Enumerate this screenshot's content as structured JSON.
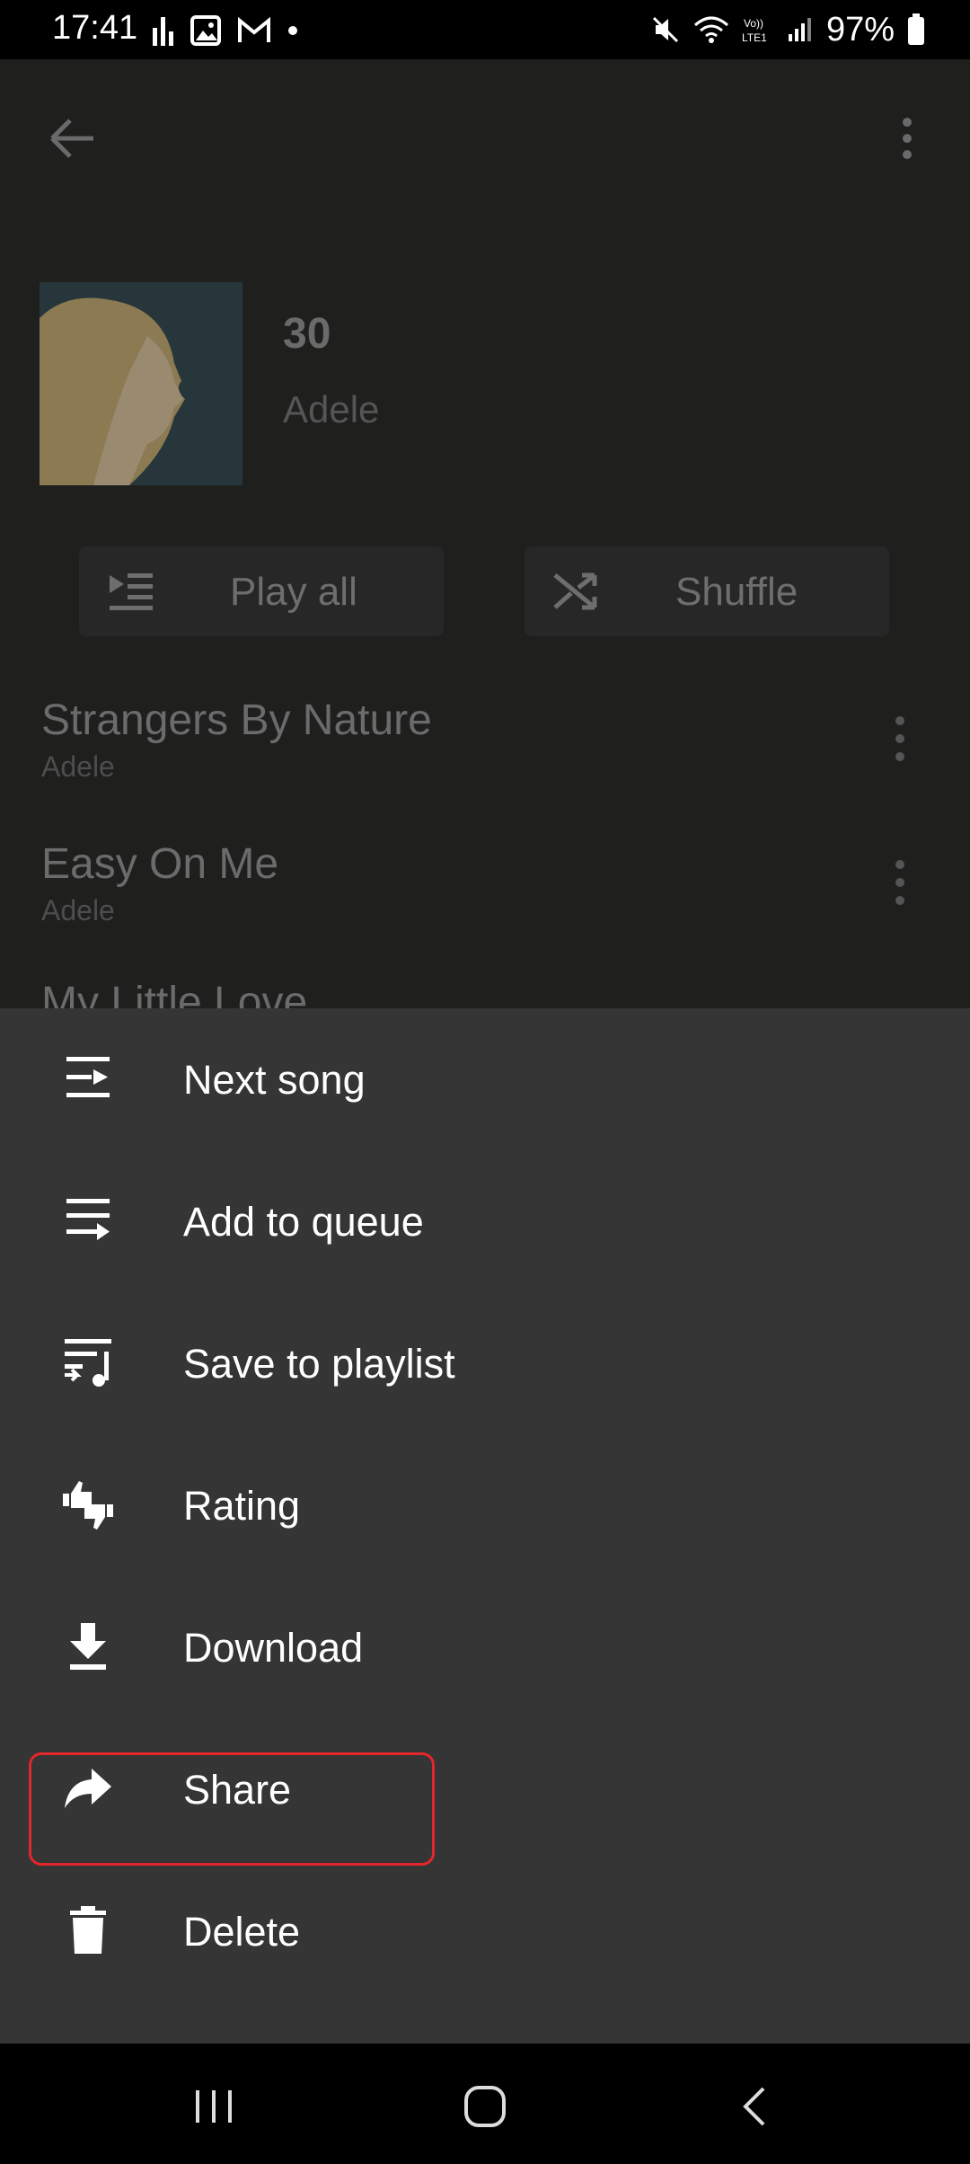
{
  "status_bar": {
    "time": "17:41",
    "battery": "97%"
  },
  "album": {
    "title": "30",
    "artist": "Adele"
  },
  "actions": {
    "play_all": "Play all",
    "shuffle": "Shuffle"
  },
  "songs": [
    {
      "title": "Strangers By Nature",
      "artist": "Adele"
    },
    {
      "title": "Easy On Me",
      "artist": "Adele"
    },
    {
      "title": "My Little Love",
      "artist": ""
    }
  ],
  "menu": {
    "items": [
      {
        "label": "Next song",
        "icon": "play-next-icon"
      },
      {
        "label": "Add to queue",
        "icon": "add-to-queue-icon"
      },
      {
        "label": "Save to playlist",
        "icon": "playlist-add-icon"
      },
      {
        "label": "Rating",
        "icon": "thumbs-icon"
      },
      {
        "label": "Download",
        "icon": "download-icon"
      },
      {
        "label": "Share",
        "icon": "share-icon"
      },
      {
        "label": "Delete",
        "icon": "delete-icon"
      }
    ],
    "highlighted_item": "Share",
    "highlight_color": "#e3262b"
  },
  "colors": {
    "sheet_bg": "#353535",
    "page_bg": "#1f1f1e"
  }
}
